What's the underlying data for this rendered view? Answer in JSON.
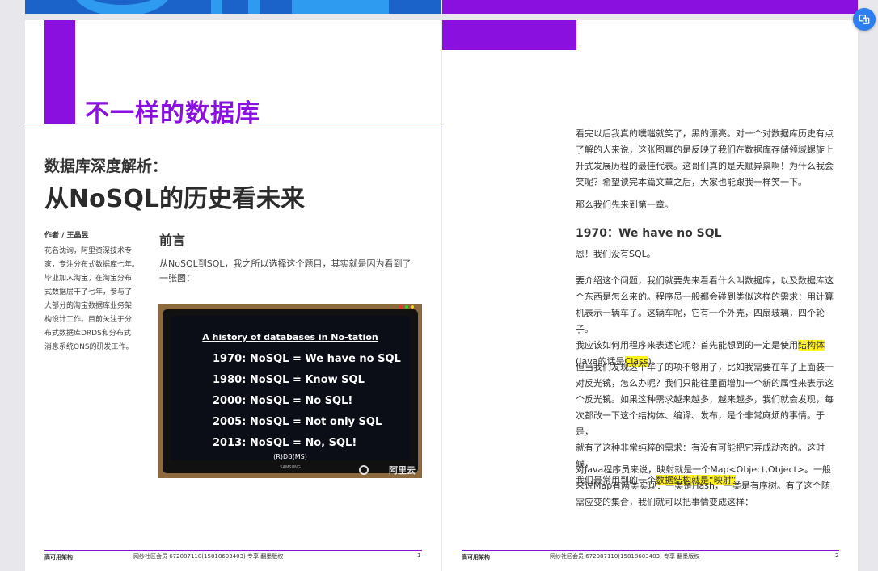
{
  "page1": {
    "chapter_title": "不一样的数据库",
    "subtitle": "数据库深度解析：",
    "main_title": "从NoSQL的历史看未来",
    "author_label": "作者 / 王晶昱",
    "author_bio_lines": [
      "花名沈询，阿里资深技术专",
      "家，专注分布式数据库七年。",
      "毕业加入淘宝，在淘宝分布",
      "式数据层干了七年，参与了",
      "大部分的淘宝数据库业务架",
      "构设计工作。目前关注于分",
      "布式数据库DRDS和分布式",
      "消息系统ONS的研发工作。"
    ],
    "preface_heading": "前言",
    "preface_lines": [
      "从NoSQL到SQL，我之所以选择这个题目，其实就是因为看到了",
      "一张图："
    ],
    "photo": {
      "title": "A history of databases in No-tation",
      "lines": [
        "1970: NoSQL = We have no SQL",
        "1980: NoSQL = Know SQL",
        "2000: NoSQL = No SQL!",
        "2005: NoSQL = Not only SQL",
        "2013: NoSQL = No, SQL!"
      ],
      "footnote": "(R)DB(MS)",
      "brand": "SAMSUNG",
      "watermark": "阿里云"
    },
    "footer": {
      "left": "高可用架构",
      "middle": "网纱社区会员 672087110(15818603403) 专享 翻墨版权",
      "page_number": "1"
    }
  },
  "page2": {
    "para1_lines": [
      "看完以后我真的噗嗤就笑了，黑的漂亮。对一个对数据库历史有点",
      "了解的人来说，这张图真的是反映了我们在数据库存储领域螺旋上",
      "升式发展历程的最佳代表。这哥们真的是天赋异禀啊！为什么我会",
      "笑呢？希望读完本篇文章之后，大家也能跟我一样笑一下。"
    ],
    "para2": "那么我们先来到第一章。",
    "heading": "1970：We have no SQL",
    "para3": "恩！我们没有SQL。",
    "para4_lines": [
      "要介绍这个问题，我们就要先来看看什么叫数据库，以及数据库这",
      "个东西是怎么来的。程序员一般都会碰到类似这样的需求：用计算",
      "机表示一辆车子。这辆车呢，它有一个外壳，四扇玻璃，四个轮子。"
    ],
    "para4_line4_pre": "我应该如何用程序来表述它呢？首先能想到的一定是使用",
    "para4_line4_hl": "结构体",
    "para4_line5_pre": "(Java的话是",
    "para4_line5_hl": "Class",
    "para4_line5_post": ")。",
    "para5_lines": [
      "但当我们发现这个车子的项不够用了，比如我需要在车子上面装一",
      "对反光镜，怎么办呢？我们只能往里面增加一个新的属性来表示这",
      "个反光镜。如果这种需求越来越多，越来越多，我们就会发现，每",
      "次都改一下这个结构体、编译、发布，是个非常麻烦的事情。于是，",
      "就有了这种非常纯粹的需求：有没有可能把它弄成动态的。这时候，"
    ],
    "para5_last_pre": "我们最常用到的一个",
    "para5_last_hl": "数据结构就是“映射”",
    "para5_last_post": "。",
    "para6_lines": [
      "对Java程序员来说，映射就是一个Map<Object,Object>。一般",
      "来说Map有两类实现：一类是Hash，一类是有序树。有了这个随",
      "需应变的集合，我们就可以把事情变成这样："
    ],
    "footer": {
      "left": "高可用架构",
      "middle": "网纱社区会员 672087110(15818603403) 专享 翻墨版权",
      "page_number": "2"
    }
  },
  "colors": {
    "accent_purple": "#8a10e0",
    "highlight_yellow": "#fff21a",
    "button_blue": "#2d7ef0"
  },
  "icons": {
    "sidebar_button": "translate-icon"
  }
}
